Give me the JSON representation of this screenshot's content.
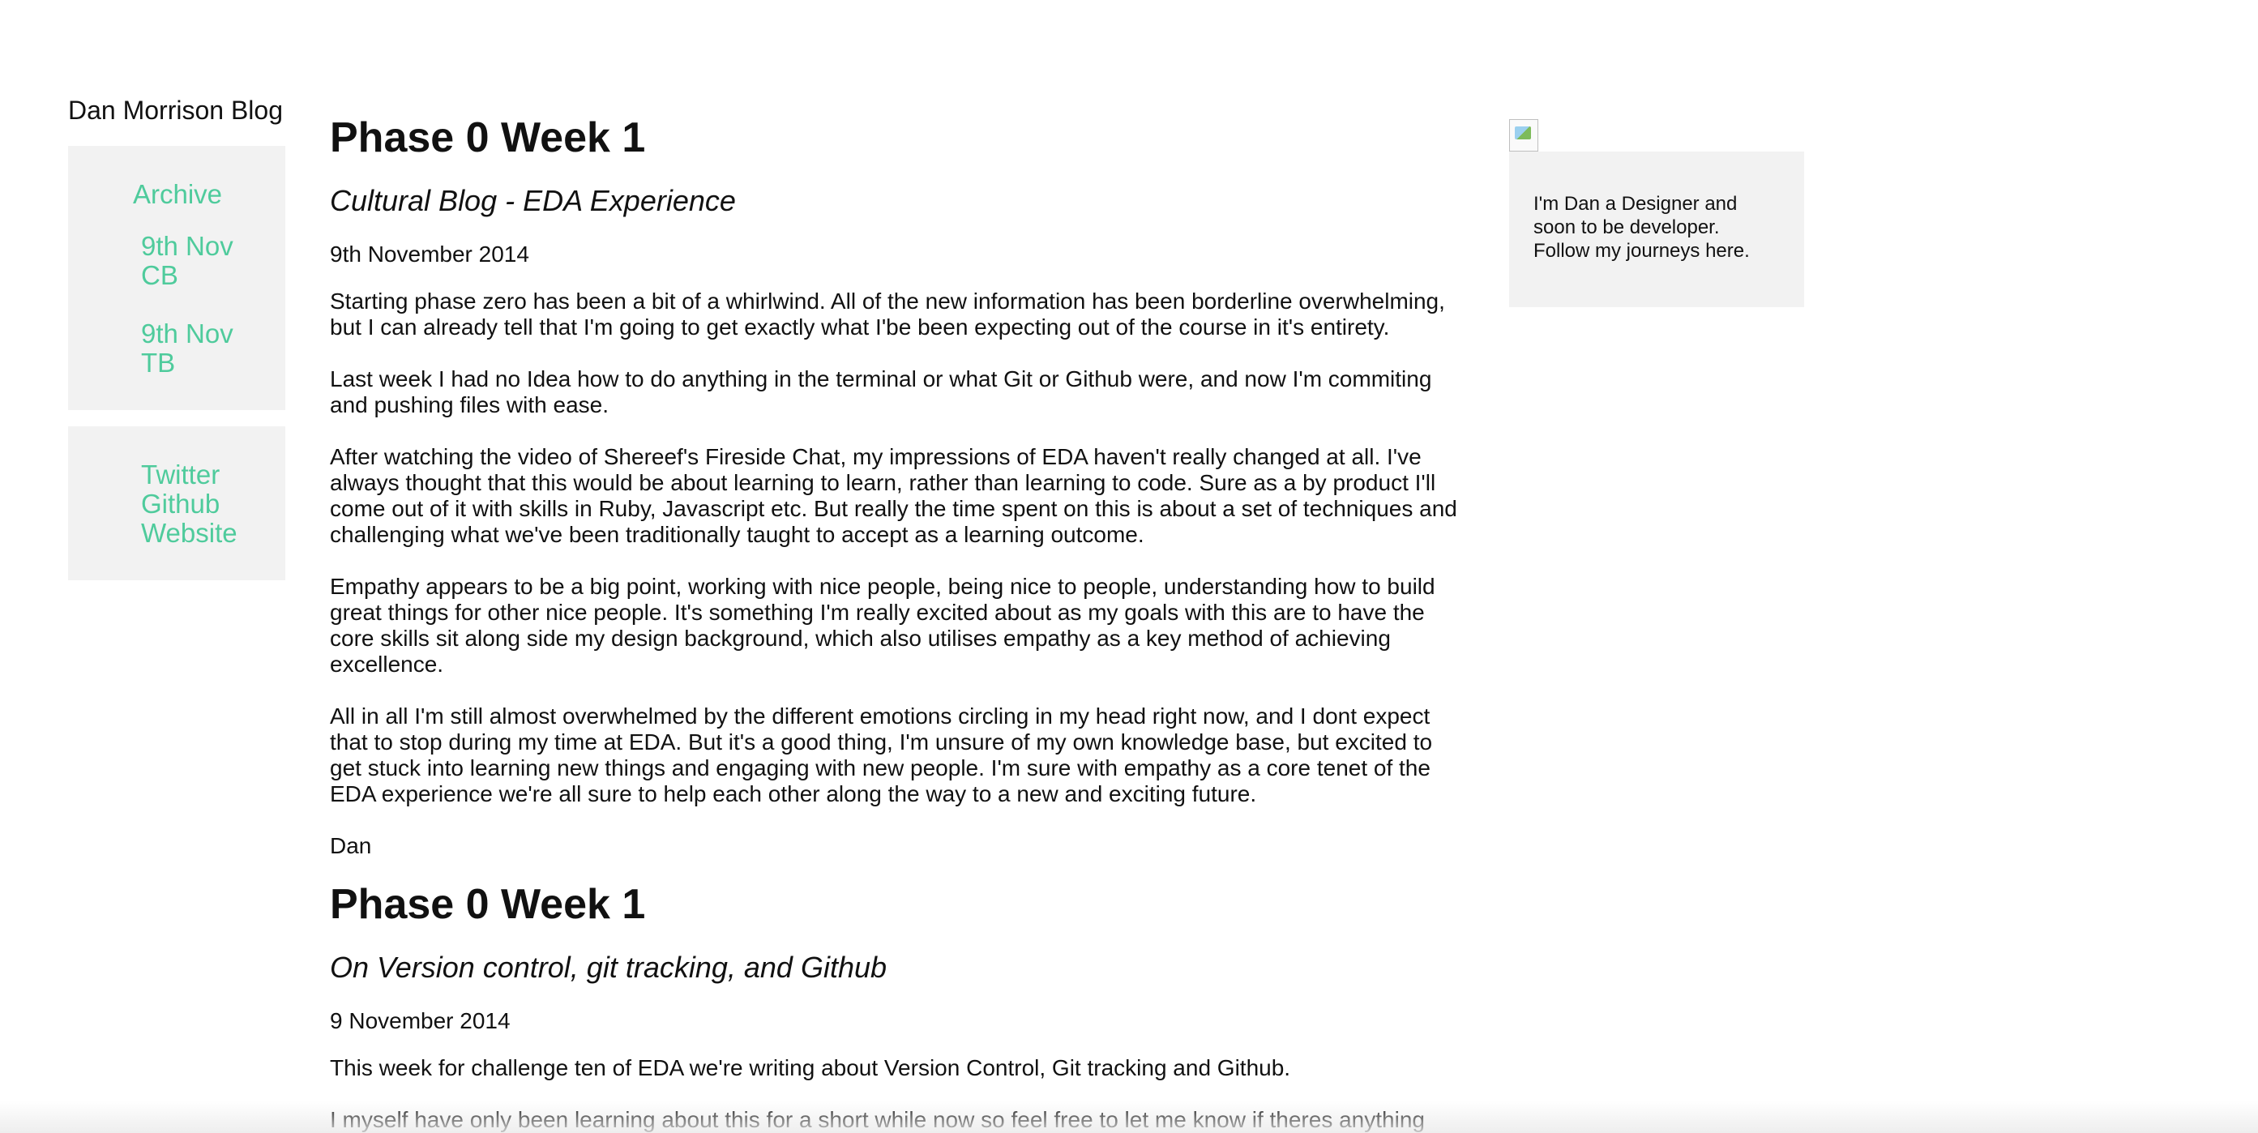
{
  "sidebar": {
    "site_title": "Dan Morrison Blog",
    "archive_title": "Archive",
    "archive_links": [
      "9th Nov CB",
      "9th Nov TB"
    ],
    "social_links": [
      "Twitter",
      "Github",
      "Website"
    ]
  },
  "posts": [
    {
      "title": "Phase 0 Week 1",
      "subtitle": "Cultural Blog - EDA Experience",
      "date": "9th November 2014",
      "paragraphs": [
        "Starting phase zero has been a bit of a whirlwind. All of the new information has been borderline overwhelming, but I can already tell that I'm going to get exactly what I'be been expecting out of the course in it's entirety.",
        "Last week I had no Idea how to do anything in the terminal or what Git or Github were, and now I'm commiting and pushing files with ease.",
        "After watching the video of Shereef's Fireside Chat, my impressions of EDA haven't really changed at all. I've always thought that this would be about learning to learn, rather than learning to code. Sure as a by product I'll come out of it with skills in Ruby, Javascript etc. But really the time spent on this is about a set of techniques and challenging what we've been traditionally taught to accept as a learning outcome.",
        "Empathy appears to be a big point, working with nice people, being nice to people, understanding how to build great things for other nice people. It's something I'm really excited about as my goals with this are to have the core skills sit along side my design background, which also utilises empathy as a key method of achieving excellence.",
        "All in all I'm still almost overwhelmed by the different emotions circling in my head right now, and I dont expect that to stop during my time at EDA. But it's a good thing, I'm unsure of my own knowledge base, but excited to get stuck into learning new things and engaging with new people. I'm sure with empathy as a core tenet of the EDA experience we're all sure to help each other along the way to a new and exciting future."
      ],
      "signature": "Dan"
    },
    {
      "title": "Phase 0 Week 1",
      "subtitle": "On Version control, git tracking, and Github",
      "date": "9 November 2014",
      "paragraphs": [
        "This week for challenge ten of EDA we're writing about Version Control, Git tracking and Github.",
        "I myself have only been learning about this for a short while now so feel free to let me know if theres anything"
      ]
    }
  ],
  "profile": {
    "image_icon": "broken-image-icon",
    "bio": "I'm Dan a Designer and soon to be developer. Follow my journeys here."
  },
  "colors": {
    "accent": "#4fcb9c",
    "panel_bg": "#f2f2f2",
    "text": "#111111"
  }
}
